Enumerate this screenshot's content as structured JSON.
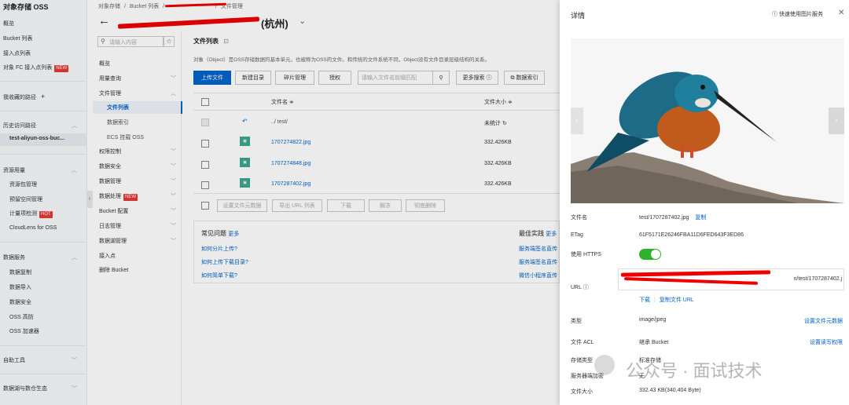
{
  "sidebar": {
    "title": "对象存储 OSS",
    "items": [
      {
        "label": "概览"
      },
      {
        "label": "Bucket 列表"
      },
      {
        "label": "接入点列表"
      },
      {
        "label": "对象 FC 接入点列表",
        "badge": "NEW"
      }
    ],
    "favorites": "我收藏的路径",
    "history": "历史访问路径",
    "history_item": "test-aliyun-oss-buc...",
    "resource": "资源用量",
    "resource_items": [
      {
        "label": "资源包管理"
      },
      {
        "label": "预留空间管理"
      },
      {
        "label": "计量项检测",
        "badge": "HOT"
      },
      {
        "label": "CloudLens for OSS"
      }
    ],
    "data_service": "数据服务",
    "data_items": [
      {
        "label": "数据复制"
      },
      {
        "label": "数据导入"
      },
      {
        "label": "数据安全"
      },
      {
        "label": "OSS 高防"
      },
      {
        "label": "OSS 加速器"
      }
    ],
    "tools": "自助工具",
    "ecosystem": "数据湖与数仓生态"
  },
  "breadcrumb": {
    "items": [
      "对象存储",
      "Bucket 列表",
      "文件管理"
    ],
    "bucket_suffix": "(杭州)"
  },
  "subnav": {
    "search_placeholder": "请输入内容",
    "items": [
      {
        "label": "概览"
      },
      {
        "label": "用量查询"
      },
      {
        "label": "文件管理"
      },
      {
        "label": "文件列表"
      },
      {
        "label": "数据索引"
      },
      {
        "label": "ECS 挂载 OSS"
      },
      {
        "label": "权限控制"
      },
      {
        "label": "数据安全"
      },
      {
        "label": "数据管理"
      },
      {
        "label": "数据处理",
        "badge": "NEW"
      },
      {
        "label": "Bucket 配置"
      },
      {
        "label": "日志管理"
      },
      {
        "label": "数据湖管理"
      },
      {
        "label": "接入点"
      },
      {
        "label": "删除 Bucket"
      }
    ]
  },
  "main": {
    "title": "文件列表",
    "description": "对象（Object）是OSS存储数据的基本单元，也被称为OSS的文件。和传统的文件系统不同，Object没有文件目录层级结构的关系。",
    "toolbar": {
      "upload": "上传文件",
      "new_dir": "新建目录",
      "fragments": "碎片管理",
      "auth": "授权",
      "search_placeholder": "请输入文件名前缀匹配",
      "more_search": "更多搜索",
      "data_index": "数据索引"
    },
    "columns": {
      "name": "文件名",
      "size": "文件大小"
    },
    "parent_row": {
      "name": "../ test/",
      "size": "未统计"
    },
    "rows": [
      {
        "name": "1707274822.jpg",
        "size": "332.426KB"
      },
      {
        "name": "1707274848.jpg",
        "size": "332.426KB"
      },
      {
        "name": "1707287402.jpg",
        "size": "332.426KB"
      }
    ],
    "bulk_actions": [
      "设置文件元数据",
      "导出 URL 列表",
      "下载",
      "解冻",
      "彻底删除"
    ],
    "faq": {
      "title": "常见问题",
      "more": "更多",
      "items": [
        "如何分片上传?",
        "如何上传下载目录?",
        "如何简单下载?"
      ]
    },
    "best_practice": {
      "title": "最佳实践",
      "more": "更多",
      "items": [
        "服务端签名直传",
        "服务端签名直传",
        "微信小程序直传"
      ]
    }
  },
  "panel": {
    "title": "详情",
    "quick_link": "快速使用图片服务",
    "fields": {
      "filename_label": "文件名",
      "filename": "test/1707287402.jpg",
      "copy": "复制",
      "etag_label": "ETag",
      "etag": "61F5171E26246FBA11D6FED643F3ED86",
      "https_label": "使用 HTTPS",
      "https_on": true,
      "url_label": "URL",
      "url_tail": "n/test/1707287402.j",
      "download": "下载",
      "copy_url": "复制文件 URL",
      "type_label": "类型",
      "type": "image/jpeg",
      "type_action": "设置文件元数据",
      "acl_label": "文件 ACL",
      "acl": "继承 Bucket",
      "acl_action": "设置读写权限",
      "storage_label": "存储类型",
      "storage": "标准存储",
      "encrypt_label": "服务器端加密",
      "encrypt": "无",
      "size_label": "文件大小",
      "size": "332.43 KB(340,404 Byte)"
    }
  },
  "watermark": "公众号 · 面试技术",
  "colors": {
    "primary": "#0064c8",
    "toggle": "#2bb32b",
    "redact": "#e00000"
  }
}
